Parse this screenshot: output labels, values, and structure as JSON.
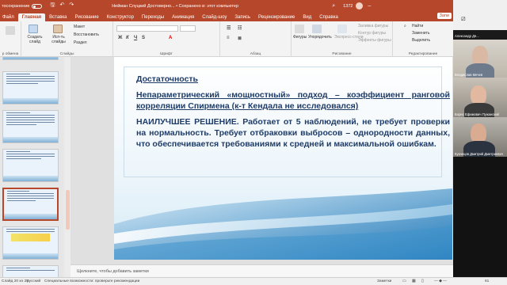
{
  "titlebar": {
    "autosave": "тосохранение",
    "document": "Нейман Слуцкий Достоверно... • Сохранено в: этот компьютер",
    "user_initials": "1372"
  },
  "tabs": [
    "Файл",
    "Главная",
    "Вставка",
    "Рисование",
    "Конструктор",
    "Переходы",
    "Анимация",
    "Слайд-шоу",
    "Запись",
    "Рецензирование",
    "Вид",
    "Справка"
  ],
  "share_label": "Запи",
  "ribbon": {
    "clipboard_label": "р обмена",
    "new_slide": "Создать слайд",
    "reuse_slides": "Исп-ть слайды",
    "layout": "Макет",
    "reset": "Восстановить",
    "section": "Раздел",
    "slides_label": "Слайды",
    "font_label": "Шрифт",
    "paragraph_label": "Абзац",
    "shapes": "Фигуры",
    "arrange": "Упорядочить",
    "quick_styles": "Экспресс-стили",
    "fill": "Заливка фигуры",
    "outline": "Контур фигуры",
    "effects": "Эффекты фигуры",
    "drawing_label": "Рисование",
    "find": "Найти",
    "replace": "Заменить",
    "select": "Выделить",
    "editing_label": "Редактирование"
  },
  "slide": {
    "heading": "Достаточность",
    "para1": "Непараметрический «мощностный» подход – коэффициент ранговой корреляции Спирмена (к-т Кендала не исследовался)",
    "para2": "НАИЛУЧШЕЕ РЕШЕНИЕ. Работает от 5 наблюдений, не требует проверки на нормальность. Требует отбраковки выбросов – однородности данных, что обеспечивается требованиями к средней и максимальной ошибкам."
  },
  "notes_placeholder": "Щелкните, чтобы добавить заметки",
  "status": {
    "slide_of": "Слайд 20 из 28",
    "language": "русский",
    "accessibility": "Специальные возможности: проверьте рекомендации",
    "notes": "Заметки",
    "zoom": "61"
  },
  "participants": [
    {
      "name": "Александр Дя..."
    },
    {
      "name": "Владислав Мечев"
    },
    {
      "name": "Борис Ефимович Пужанский"
    },
    {
      "name": "Кузнецов Дмитрий Дмитриевич"
    }
  ],
  "colors": {
    "brand": "#b7472a",
    "slide_text": "#1f3c68"
  }
}
